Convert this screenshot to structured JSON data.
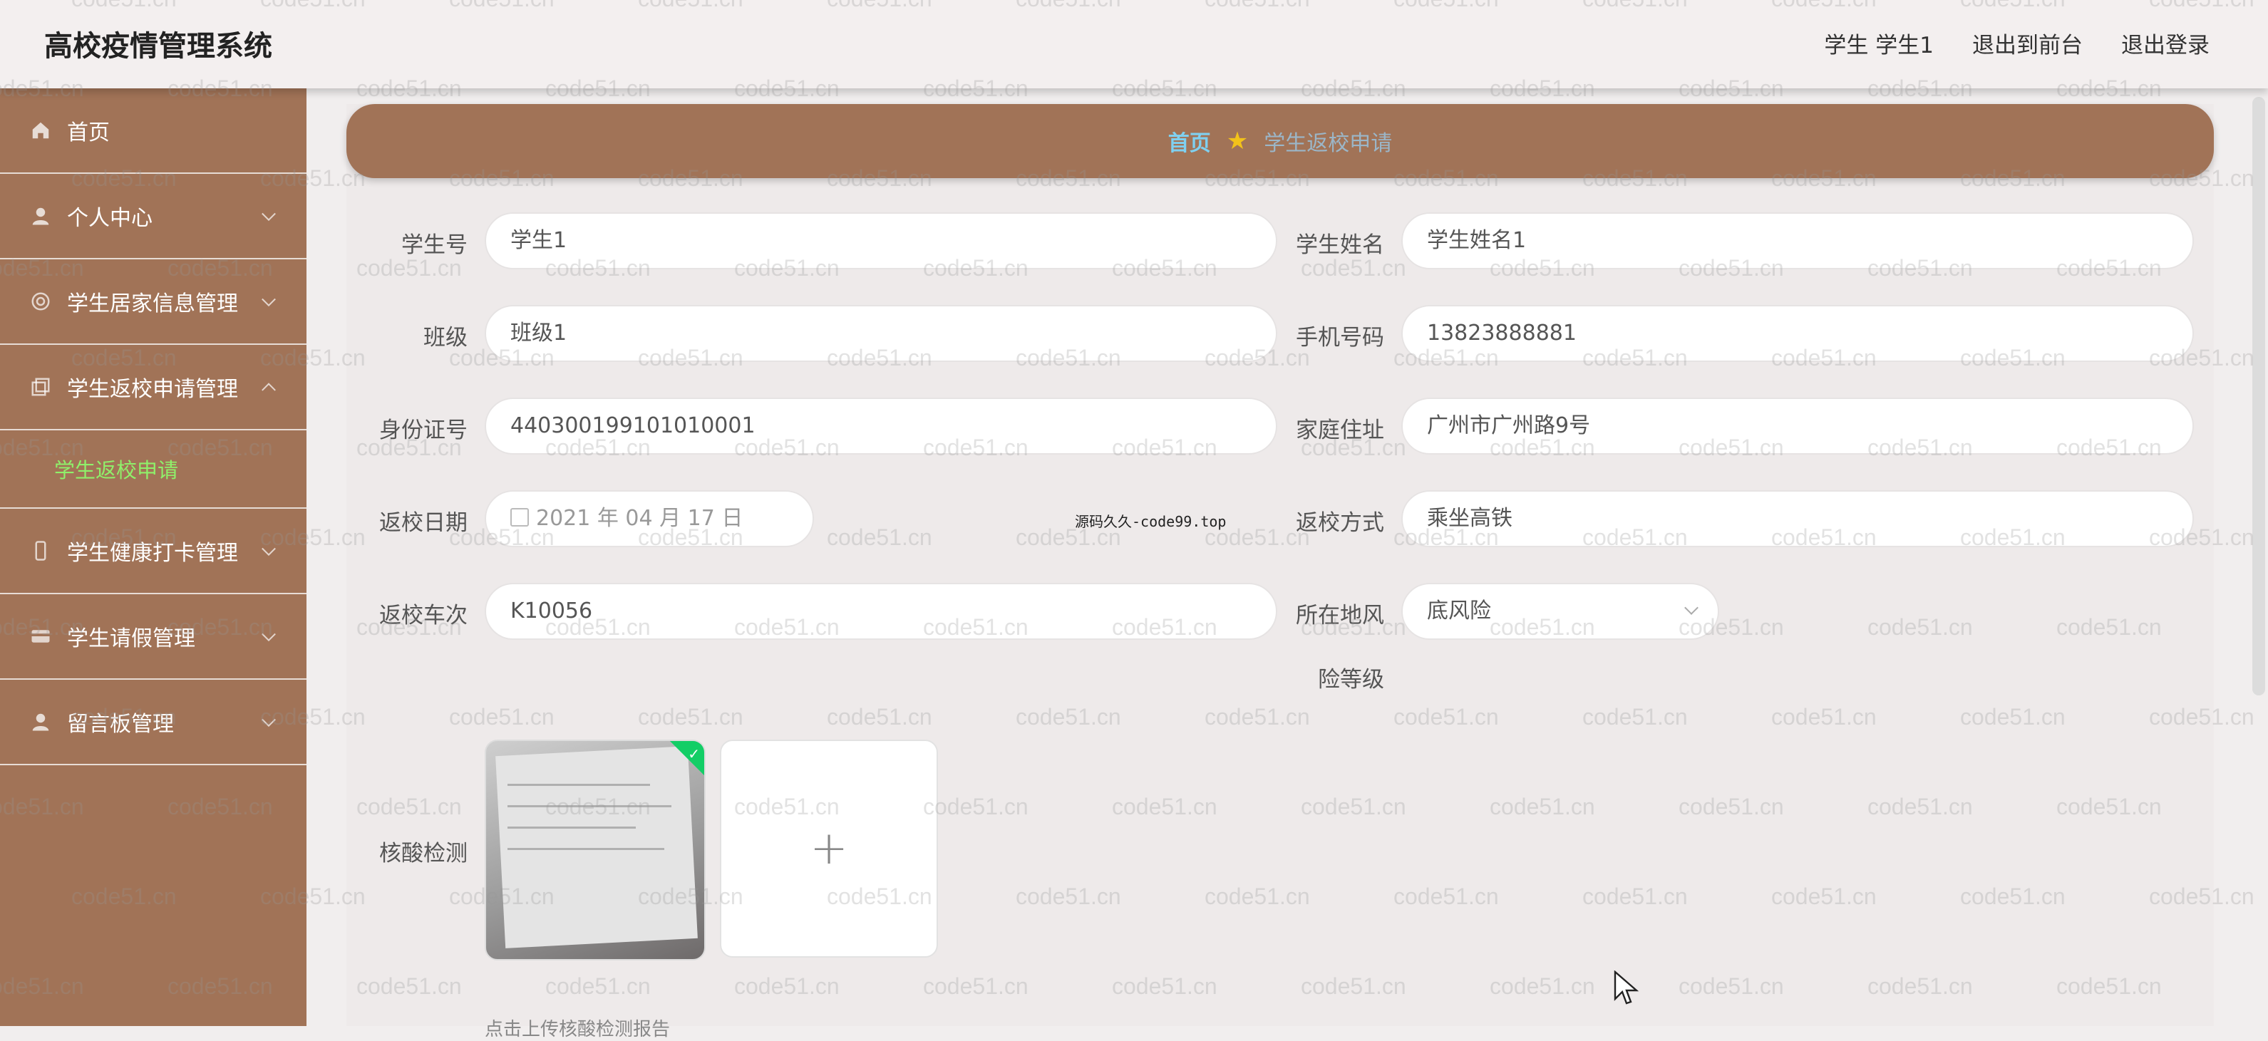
{
  "header": {
    "title": "高校疫情管理系统",
    "user": "学生 学生1",
    "back_front": "退出到前台",
    "logout": "退出登录"
  },
  "sidebar": {
    "items": [
      {
        "label": "首页",
        "icon": "home-icon"
      },
      {
        "label": "个人中心",
        "icon": "user-icon"
      },
      {
        "label": "学生居家信息管理",
        "icon": "grid-icon"
      },
      {
        "label": "学生返校申请管理",
        "icon": "copy-icon",
        "expanded": true
      },
      {
        "label": "学生健康打卡管理",
        "icon": "phone-icon"
      },
      {
        "label": "学生请假管理",
        "icon": "card-icon"
      },
      {
        "label": "留言板管理",
        "icon": "user-icon"
      }
    ],
    "sub_active": "学生返校申请"
  },
  "breadcrumb": {
    "home": "首页",
    "current": "学生返校申请"
  },
  "form": {
    "student_no_label": "学生号",
    "student_no": "学生1",
    "student_name_label": "学生姓名",
    "student_name": "学生姓名1",
    "class_label": "班级",
    "class_value": "班级1",
    "phone_label": "手机号码",
    "phone": "13823888881",
    "id_label": "身份证号",
    "id_value": "440300199101010001",
    "address_label": "家庭住址",
    "address": "广州市广州路9号",
    "return_date_label": "返校日期",
    "return_date": "2021 年 04 月 17 日",
    "return_method_label": "返校方式",
    "return_method": "乘坐高铁",
    "train_label": "返校车次",
    "train": "K10056",
    "risk_label_line1": "所在地风",
    "risk_label_line2": "险等级",
    "risk": "底风险",
    "nucleic_label": "核酸检测",
    "upload_plus": "+",
    "upload_tip": "点击上传核酸检测报告"
  },
  "watermark_note": "源码久久-code99.top",
  "watermark": "code51.cn",
  "colors": {
    "sidebar": "#a17357",
    "active_sub": "#8ff06a",
    "crumb_home": "#7fd0f0",
    "star": "#f2c21a"
  }
}
